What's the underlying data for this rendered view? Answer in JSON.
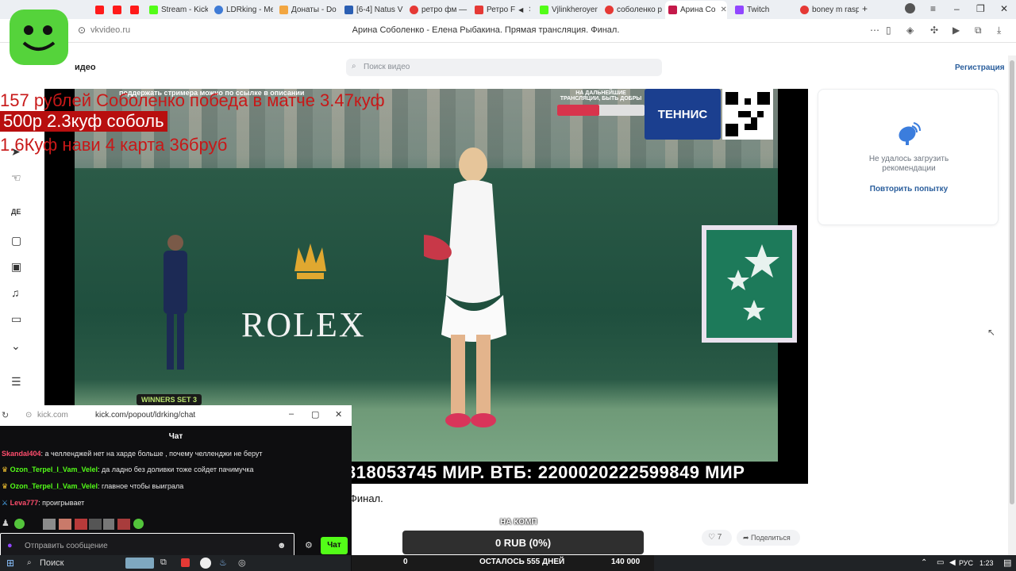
{
  "tabs": [
    {
      "label": "",
      "color": "#ff1a1a"
    },
    {
      "label": "",
      "color": "#ff1a1a"
    },
    {
      "label": "",
      "color": "#ff1a1a"
    },
    {
      "label": "Stream - Kick",
      "color": "#53fc18"
    },
    {
      "label": "LDRking - Me",
      "color": "#3f7bd6"
    },
    {
      "label": "Донаты - Do",
      "color": "#f2a641"
    },
    {
      "label": "[6-4] Natus V",
      "color": "#2b5fb3"
    },
    {
      "label": "ретро фм —",
      "color": "#e53935"
    },
    {
      "label": "Ретро F",
      "color": "#e53935"
    },
    {
      "label": "Vjlinkheroyer",
      "color": "#53fc18"
    },
    {
      "label": "соболенко р",
      "color": "#e53935"
    },
    {
      "label": "Арина Со",
      "color": "#c4194a"
    },
    {
      "label": "Twitch",
      "color": "#9146ff"
    },
    {
      "label": "boney m rasp",
      "color": "#e53935"
    }
  ],
  "browser": {
    "url": "vkvideo.ru",
    "page_title": "Арина Соболенко - Елена Рыбакина. Прямая трансляция. Финал."
  },
  "vk": {
    "brand": "идео",
    "search_placeholder": "Поиск видео",
    "register": "Регистрация",
    "recs_message_1": "Не удалось загрузить",
    "recs_message_2": "рекомендации",
    "retry": "Повторить попытку",
    "title_fragment": "Финал.",
    "likes": "7",
    "share": "Поделиться"
  },
  "video": {
    "top_note": "поддержать стримера можно по ссылке в описании",
    "goal_text": "НА ДАЛЬНЕЙШИЕ ТРАНСЛЯЦИИ, БЫТЬ ДОБРЫ",
    "goal_progress_pct": 48,
    "tennis_logo": "ТЕННИС",
    "court_sign": "ROLEX",
    "winners": "WINNERS SET 3",
    "ticker": "318053745 МИР. ВТБ: 2200020222599849 МИР"
  },
  "overlay": {
    "line1": "157 рублей Соболенко победа в матче 3.47куф",
    "line2": "500р 2.3куф соболь",
    "line3": "1.6Куф нави 4 карта 36бруб"
  },
  "donation": {
    "label": "НА КОМП",
    "amount": "0 RUB (0%)",
    "left_value": "0",
    "days_left": "ОСТАЛОСЬ 555 ДНЕЙ",
    "target": "140 000"
  },
  "chat": {
    "url_host": "kick.com",
    "url_path": "kick.com/popout/ldrking/chat",
    "header": "Чат",
    "messages": [
      {
        "user": "Skandal404",
        "text": ": а челленджей нет на харде больше , почему челленджи не берут",
        "color": "#ff4d6d"
      },
      {
        "user": "Ozon_Terpel_I_Vam_Velel",
        "text": ": да ладно без доливки тоже сойдет пачимучка",
        "color": "#53fc18"
      },
      {
        "user": "Ozon_Terpel_I_Vam_Velel",
        "text": ": главное чтобы выиграла",
        "color": "#53fc18"
      },
      {
        "user": "Leva777",
        "text": ": проигрывает",
        "color": "#ff4d6d"
      }
    ],
    "input_placeholder": "Отправить сообщение",
    "send": "Чат"
  },
  "taskbar": {
    "search": "Поиск",
    "lang": "РУС",
    "time": "1:23"
  }
}
